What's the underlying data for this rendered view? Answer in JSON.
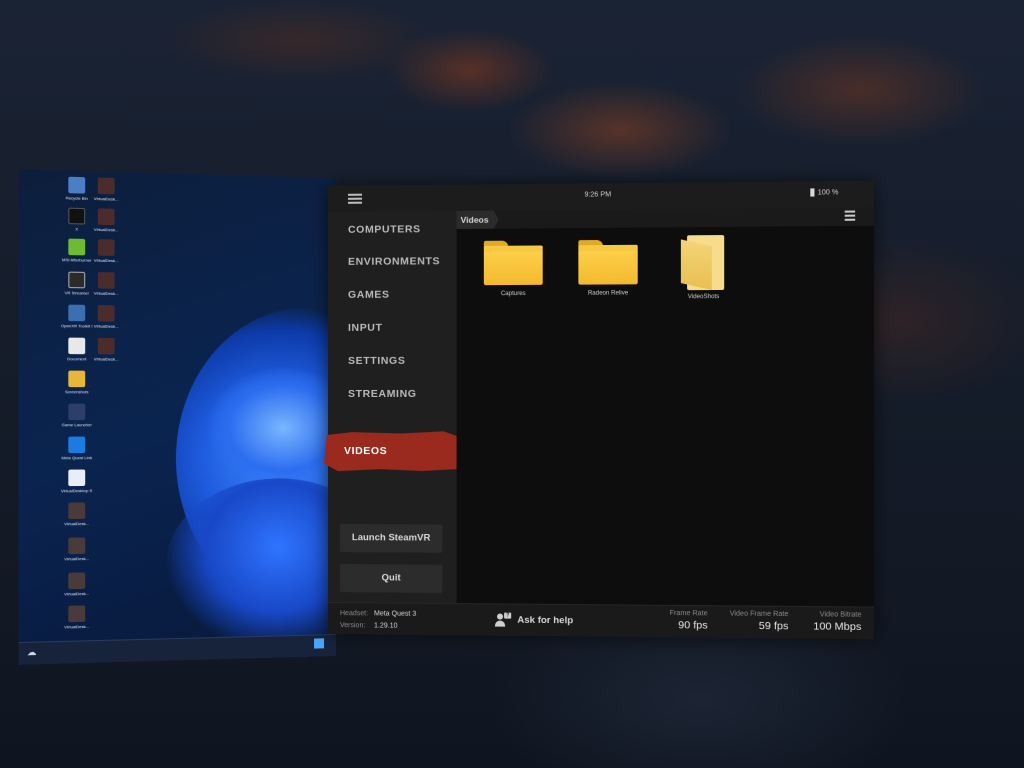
{
  "app": {
    "status_bar": {
      "time": "9:26 PM",
      "battery": "100 %"
    },
    "sidebar": {
      "items": [
        {
          "label": "COMPUTERS"
        },
        {
          "label": "ENVIRONMENTS"
        },
        {
          "label": "GAMES"
        },
        {
          "label": "INPUT"
        },
        {
          "label": "SETTINGS"
        },
        {
          "label": "STREAMING"
        },
        {
          "label": "VIDEOS"
        }
      ],
      "active": "VIDEOS",
      "launch_label": "Launch SteamVR",
      "quit_label": "Quit"
    },
    "content": {
      "breadcrumb": "Videos",
      "folders": [
        {
          "name": "Captures",
          "icon": "folder-icon"
        },
        {
          "name": "Radeon Relive",
          "icon": "folder-icon"
        },
        {
          "name": "VideoShots",
          "icon": "open-folder-icon"
        }
      ]
    },
    "footer": {
      "headset_label": "Headset:",
      "headset_value": "Meta Quest 3",
      "version_label": "Version:",
      "version_value": "1.29.10",
      "help_label": "Ask for help",
      "stats": [
        {
          "label": "Frame Rate",
          "value": "90 fps"
        },
        {
          "label": "Video Frame Rate",
          "value": "59 fps"
        },
        {
          "label": "Video Bitrate",
          "value": "100 Mbps"
        }
      ]
    },
    "colors": {
      "accent": "#9a2a1d",
      "folder": "#f3b92e",
      "panel": "#121212"
    }
  },
  "desktop": {
    "icons": [
      {
        "label": "Recycle Bin"
      },
      {
        "label": "VirtualDesk..."
      },
      {
        "label": "X"
      },
      {
        "label": "VirtualDesk..."
      },
      {
        "label": "MSI Afterburner"
      },
      {
        "label": "VirtualDesk..."
      },
      {
        "label": "VR Streamer"
      },
      {
        "label": "VirtualDesk..."
      },
      {
        "label": "OpenXR Toolkit Companion"
      },
      {
        "label": "VirtualDesk..."
      },
      {
        "label": "Document"
      },
      {
        "label": "VirtualDesk..."
      },
      {
        "label": "Screenshots"
      },
      {
        "label": "Game Launcher"
      },
      {
        "label": "Meta Quest Link"
      },
      {
        "label": "VirtualDesktop Streamer"
      },
      {
        "label": "VirtualDesk..."
      },
      {
        "label": "VirtualDesk..."
      },
      {
        "label": "VirtualDesk..."
      },
      {
        "label": "VirtualDesk..."
      }
    ]
  }
}
